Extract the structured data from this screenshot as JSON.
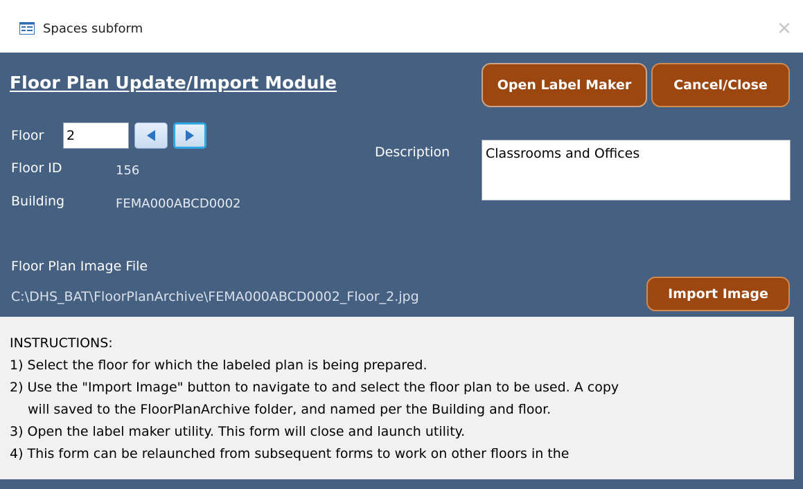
{
  "window": {
    "title": "Spaces subform",
    "close_glyph": "✕"
  },
  "form": {
    "heading": "Floor Plan Update/Import Module",
    "buttons": {
      "open_label_maker": "Open Label Maker",
      "cancel_close": "Cancel/Close",
      "import_image": "Import Image"
    },
    "floor_label": "Floor",
    "floor_value": "2",
    "floor_id_label": "Floor ID",
    "floor_id_value": "156",
    "building_label": "Building",
    "building_value": "FEMA000ABCD0002",
    "description_label": "Description",
    "description_value": "Classrooms and Offices",
    "image_file_label": "Floor Plan Image File",
    "image_file_path": "C:\\DHS_BAT\\FloorPlanArchive\\FEMA000ABCD0002_Floor_2.jpg"
  },
  "instructions": {
    "title": "INSTRUCTIONS:",
    "lines": [
      "1) Select the floor for which the labeled plan is being prepared.",
      "2) Use the \"Import Image\" button to navigate to and select the floor plan to be used.  A copy",
      "will saved to the FloorPlanArchive folder, and named per the Building and floor.",
      "3) Open the label maker utility. This form will close and launch utility.",
      "4) This form can be relaunched from subsequent forms to work on other floors in the"
    ]
  },
  "colors": {
    "form_background": "#466082",
    "button_fill": "#9c4610",
    "instructions_background": "#f1f1f1"
  },
  "icons": {
    "app": "form-icon",
    "prev": "triangle-left-icon",
    "next": "triangle-right-icon",
    "close": "close-icon"
  }
}
